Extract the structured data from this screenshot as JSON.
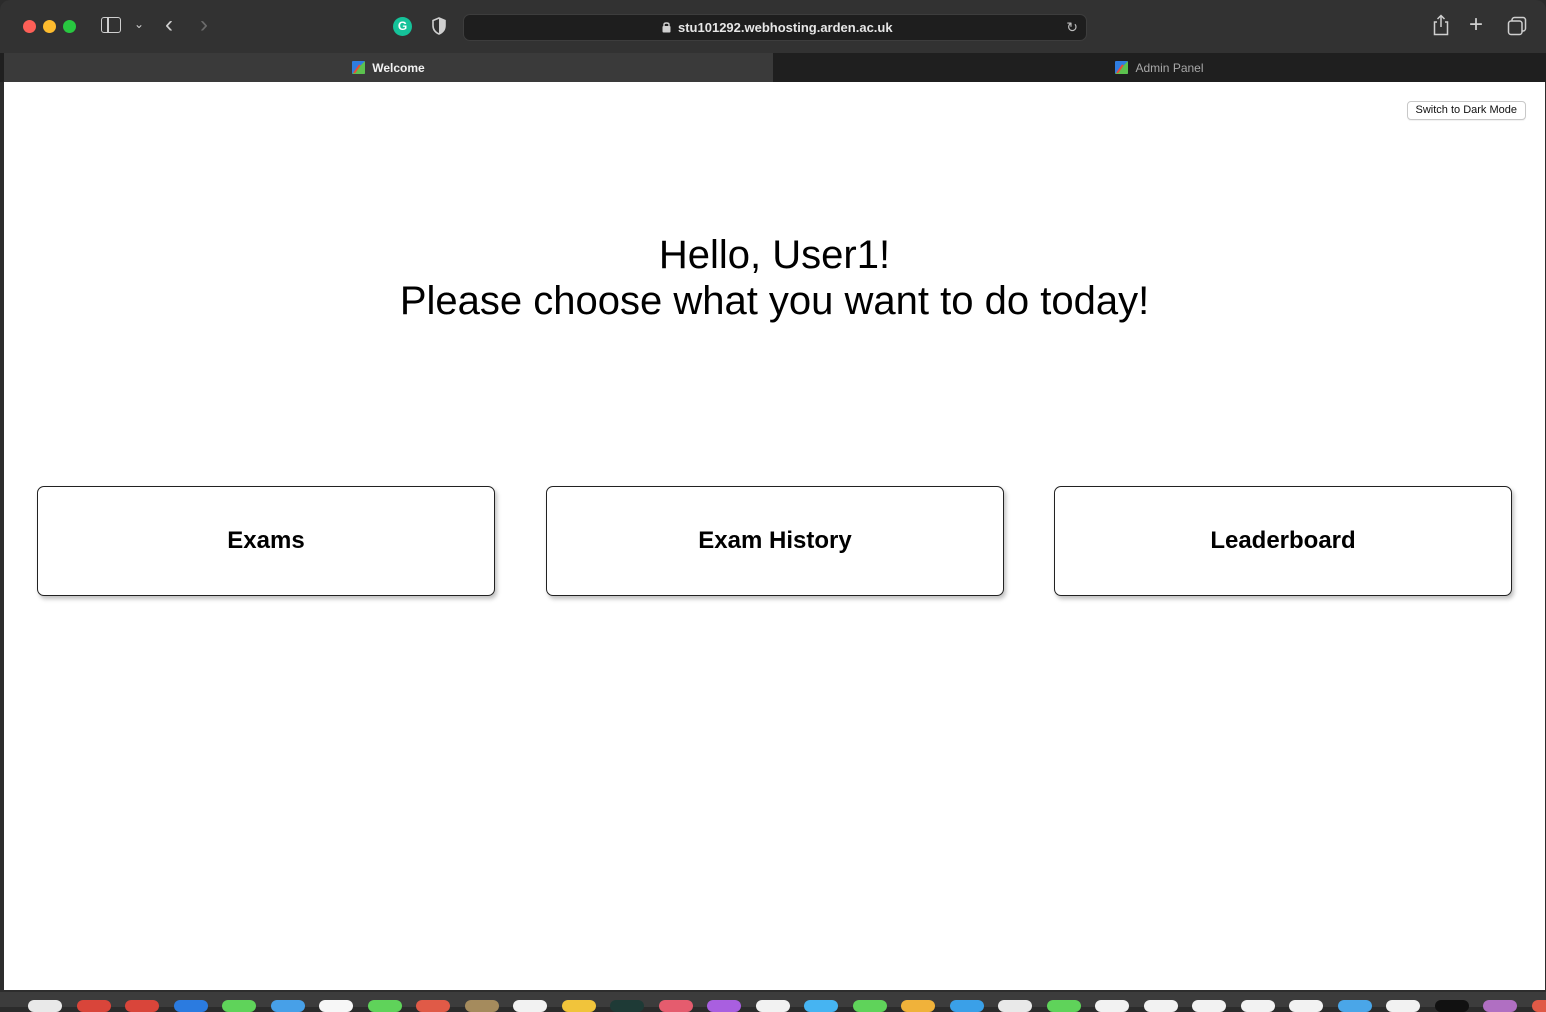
{
  "browser": {
    "url": "stu101292.webhosting.arden.ac.uk",
    "grammarly_letter": "G",
    "tabs": [
      {
        "label": "Welcome",
        "active": true
      },
      {
        "label": "Admin Panel",
        "active": false
      }
    ]
  },
  "page": {
    "dark_mode_button": "Switch to Dark Mode",
    "greeting_line1": "Hello, User1!",
    "greeting_line2": "Please choose what you want to do today!",
    "cards": [
      {
        "label": "Exams"
      },
      {
        "label": "Exam History"
      },
      {
        "label": "Leaderboard"
      }
    ]
  },
  "colors": {
    "traffic_red": "#fe5f57",
    "traffic_yellow": "#febc2e",
    "traffic_green": "#28c840",
    "page_background": "#ffffff"
  },
  "dock_items": [
    "#e9e9e9",
    "#d9453a",
    "#d9453a",
    "#2b7be0",
    "#5fd35a",
    "#47a0e8",
    "#f7f7f7",
    "#5fd35a",
    "#e05a47",
    "#a58b5d",
    "#f2f2f2",
    "#f1c43b",
    "#1e3a36",
    "#e55c6e",
    "#a95fe0",
    "#f2f2f2",
    "#46b4f2",
    "#5fd35a",
    "#f0b23a",
    "#3aa0e8",
    "#e9e9e9",
    "#5fd35a",
    "#f2f2f2",
    "#f2f2f2",
    "#f2f2f2",
    "#f2f2f2",
    "#f2f2f2",
    "#4aa6e8",
    "#f2f2f2",
    "#111111",
    "#b06fc2",
    "#e05a47"
  ]
}
